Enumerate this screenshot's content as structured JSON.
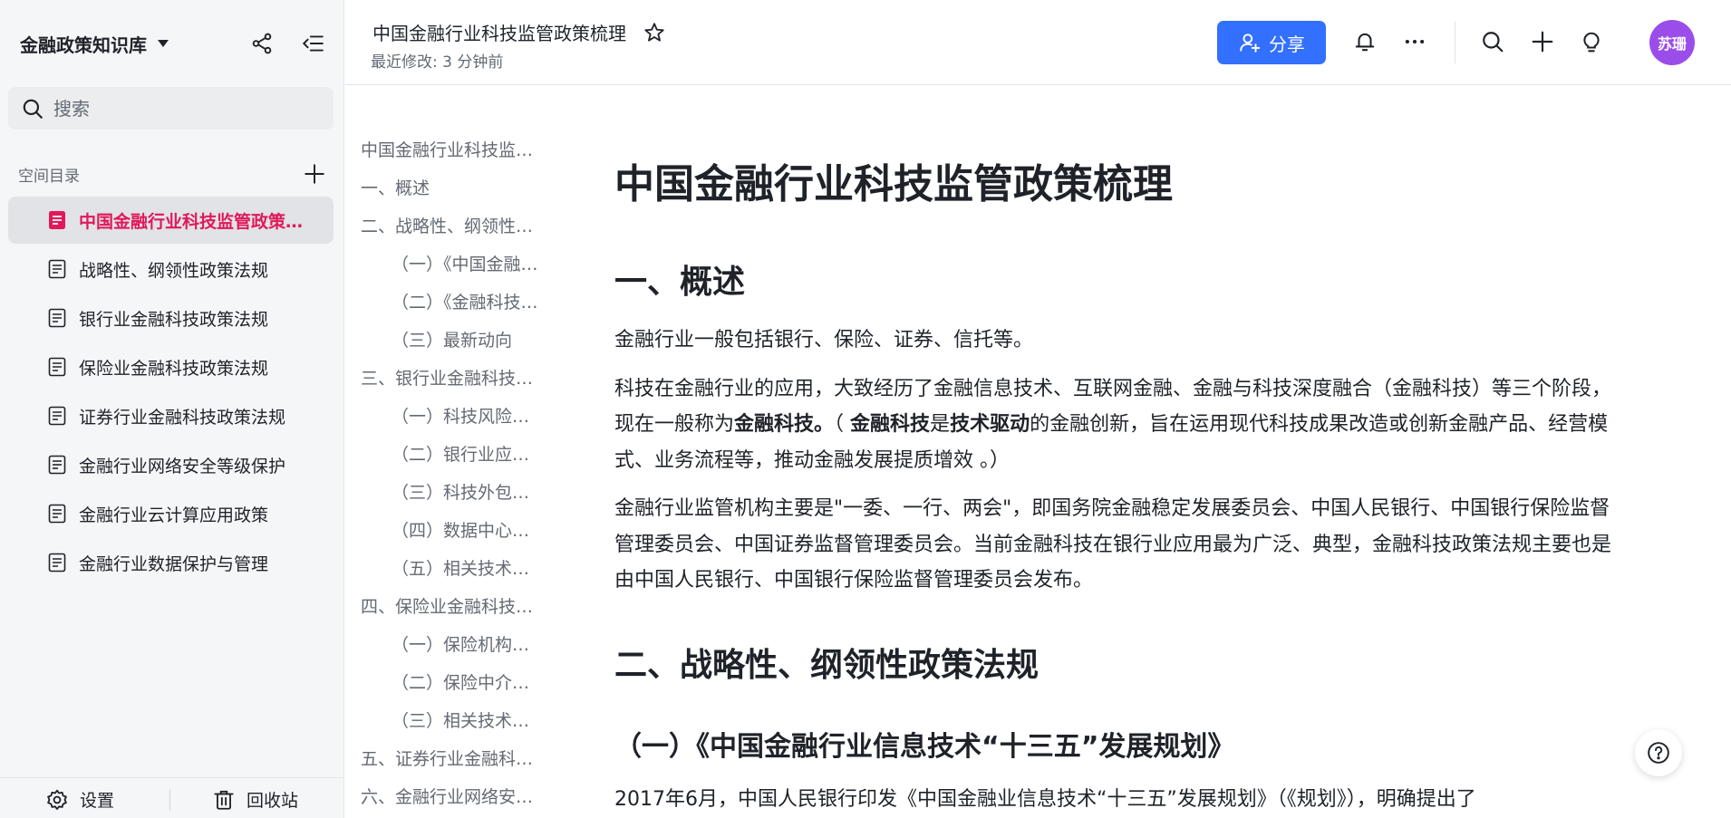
{
  "sidebar": {
    "space_title": "金融政策知识库",
    "search_placeholder": "搜索",
    "directory_label": "空间目录",
    "items": [
      {
        "label": "中国金融行业科技监管政策梳理",
        "active": true
      },
      {
        "label": "战略性、纲领性政策法规"
      },
      {
        "label": "银行业金融科技政策法规"
      },
      {
        "label": "保险业金融科技政策法规"
      },
      {
        "label": "证券行业金融科技政策法规"
      },
      {
        "label": "金融行业网络安全等级保护"
      },
      {
        "label": "金融行业云计算应用政策"
      },
      {
        "label": "金融行业数据保护与管理"
      }
    ],
    "footer": {
      "settings": "设置",
      "trash": "回收站"
    }
  },
  "header": {
    "doc_title": "中国金融行业科技监管政策梳理",
    "last_modified": "最近修改: 3 分钟前",
    "share_label": "分享",
    "avatar_text": "苏珊"
  },
  "outline": [
    {
      "label": "中国金融行业科技监管政策梳理",
      "level": 1
    },
    {
      "label": "一、概述",
      "level": 1
    },
    {
      "label": "二、战略性、纲领性政策法规",
      "level": 1
    },
    {
      "label": "（一）《中国金融行业信息技术“十三五”发展规划》",
      "level": 2
    },
    {
      "label": "（二）《金融科技发展规划》",
      "level": 2
    },
    {
      "label": "（三）最新动向",
      "level": 2
    },
    {
      "label": "三、银行业金融科技政策法规",
      "level": 1
    },
    {
      "label": "（一）科技风险管理",
      "level": 2
    },
    {
      "label": "（二）银行业应用系统",
      "level": 2
    },
    {
      "label": "（三）科技外包管理",
      "level": 2
    },
    {
      "label": "（四）数据中心管理",
      "level": 2
    },
    {
      "label": "（五）相关技术标准",
      "level": 2
    },
    {
      "label": "四、保险业金融科技政策法规",
      "level": 1
    },
    {
      "label": "（一）保险机构信息化",
      "level": 2
    },
    {
      "label": "（二）保险中介信息化",
      "level": 2
    },
    {
      "label": "（三）相关技术标准",
      "level": 2
    },
    {
      "label": "五、证券行业金融科技政策法规",
      "level": 1
    },
    {
      "label": "六、金融行业网络安全等级保护",
      "level": 1
    }
  ],
  "document": {
    "title": "中国金融行业科技监管政策梳理",
    "section1_heading": "一、概述",
    "para1": "金融行业一般包括银行、保险、证券、信托等。",
    "para2": {
      "a": "科技在金融行业的应用，大致经历了金融信息技术、互联网金融、金融与科技深度融合（金融科技）等三个阶段，现在一般称为",
      "b": "金融科技。",
      "c": "（ ",
      "d": "金融科技",
      "e": "是",
      "f": "技术驱动",
      "g": "的金融创新，旨在运用现代科技成果改造或创新金融产品、经营模式、业务流程等，推动金融发展提质增效 。）"
    },
    "para3": "金融行业监管机构主要是\"一委、一行、两会\"，即国务院金融稳定发展委员会、中国人民银行、中国银行保险监督管理委员会、中国证券监督管理委员会。当前金融科技在银行业应用最为广泛、典型，金融科技政策法规主要也是由中国人民银行、中国银行保险监督管理委员会发布。",
    "section2_heading": "二、战略性、纲领性政策法规",
    "sub1_heading": "（一）《中国金融行业信息技术“十三五”发展规划》",
    "para4": "2017年6月，中国人民银行印发《中国金融业信息技术“十三五”发展规划》（《规划》），明确提出了"
  },
  "colors": {
    "accent": "#3370ff",
    "active_item": "#e0195a",
    "avatar": "#9b4dea"
  }
}
